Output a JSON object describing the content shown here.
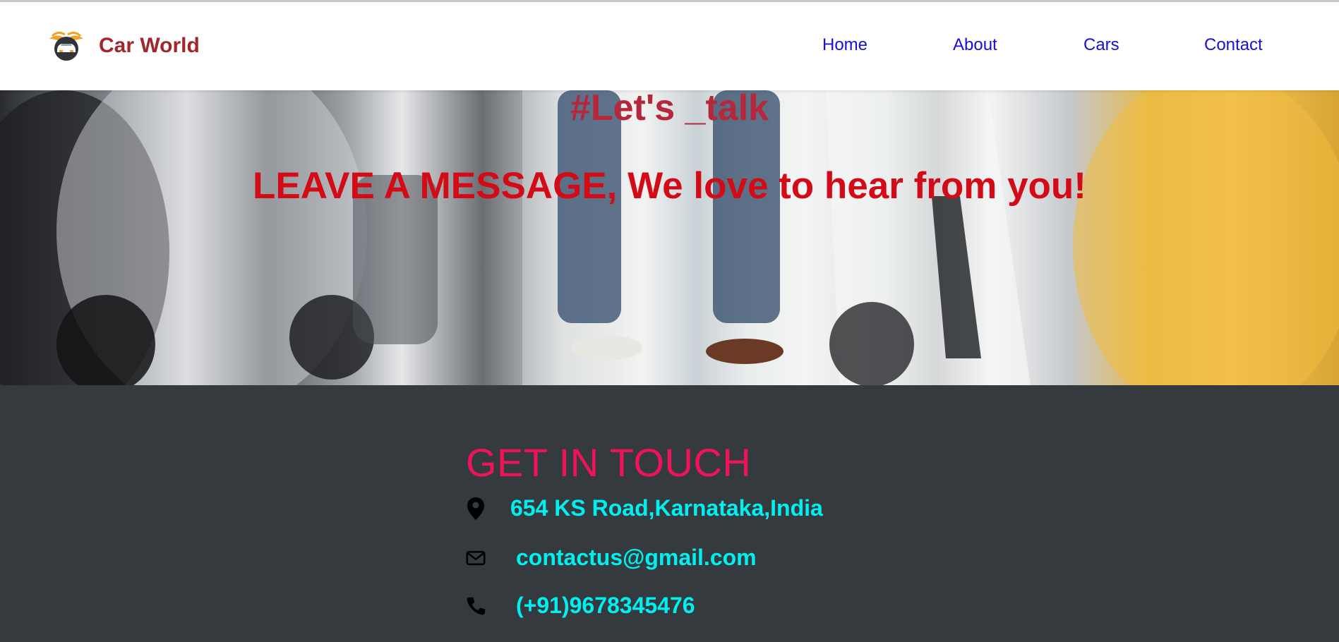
{
  "header": {
    "brand": "Car World",
    "nav": [
      "Home",
      "About",
      "Cars",
      "Contact"
    ]
  },
  "hero": {
    "tagline": "#Let's _talk",
    "message": "LEAVE A MESSAGE, We love to hear from you!"
  },
  "contact": {
    "title": "GET IN TOUCH",
    "address": "654 KS Road,Karnataka,India",
    "email": "contactus@gmail.com",
    "phone": "(+91)9678345476"
  },
  "icons": [
    "car-logo-icon",
    "map-pin-icon",
    "envelope-icon",
    "phone-icon"
  ],
  "colors": {
    "brand": "#a3262c",
    "nav_link": "#1a0dde",
    "hero_tag": "#b5283b",
    "hero_message": "#d20b16",
    "contact_bg": "#353a3e",
    "contact_title": "#f1135a",
    "contact_text": "#00f0f0"
  }
}
